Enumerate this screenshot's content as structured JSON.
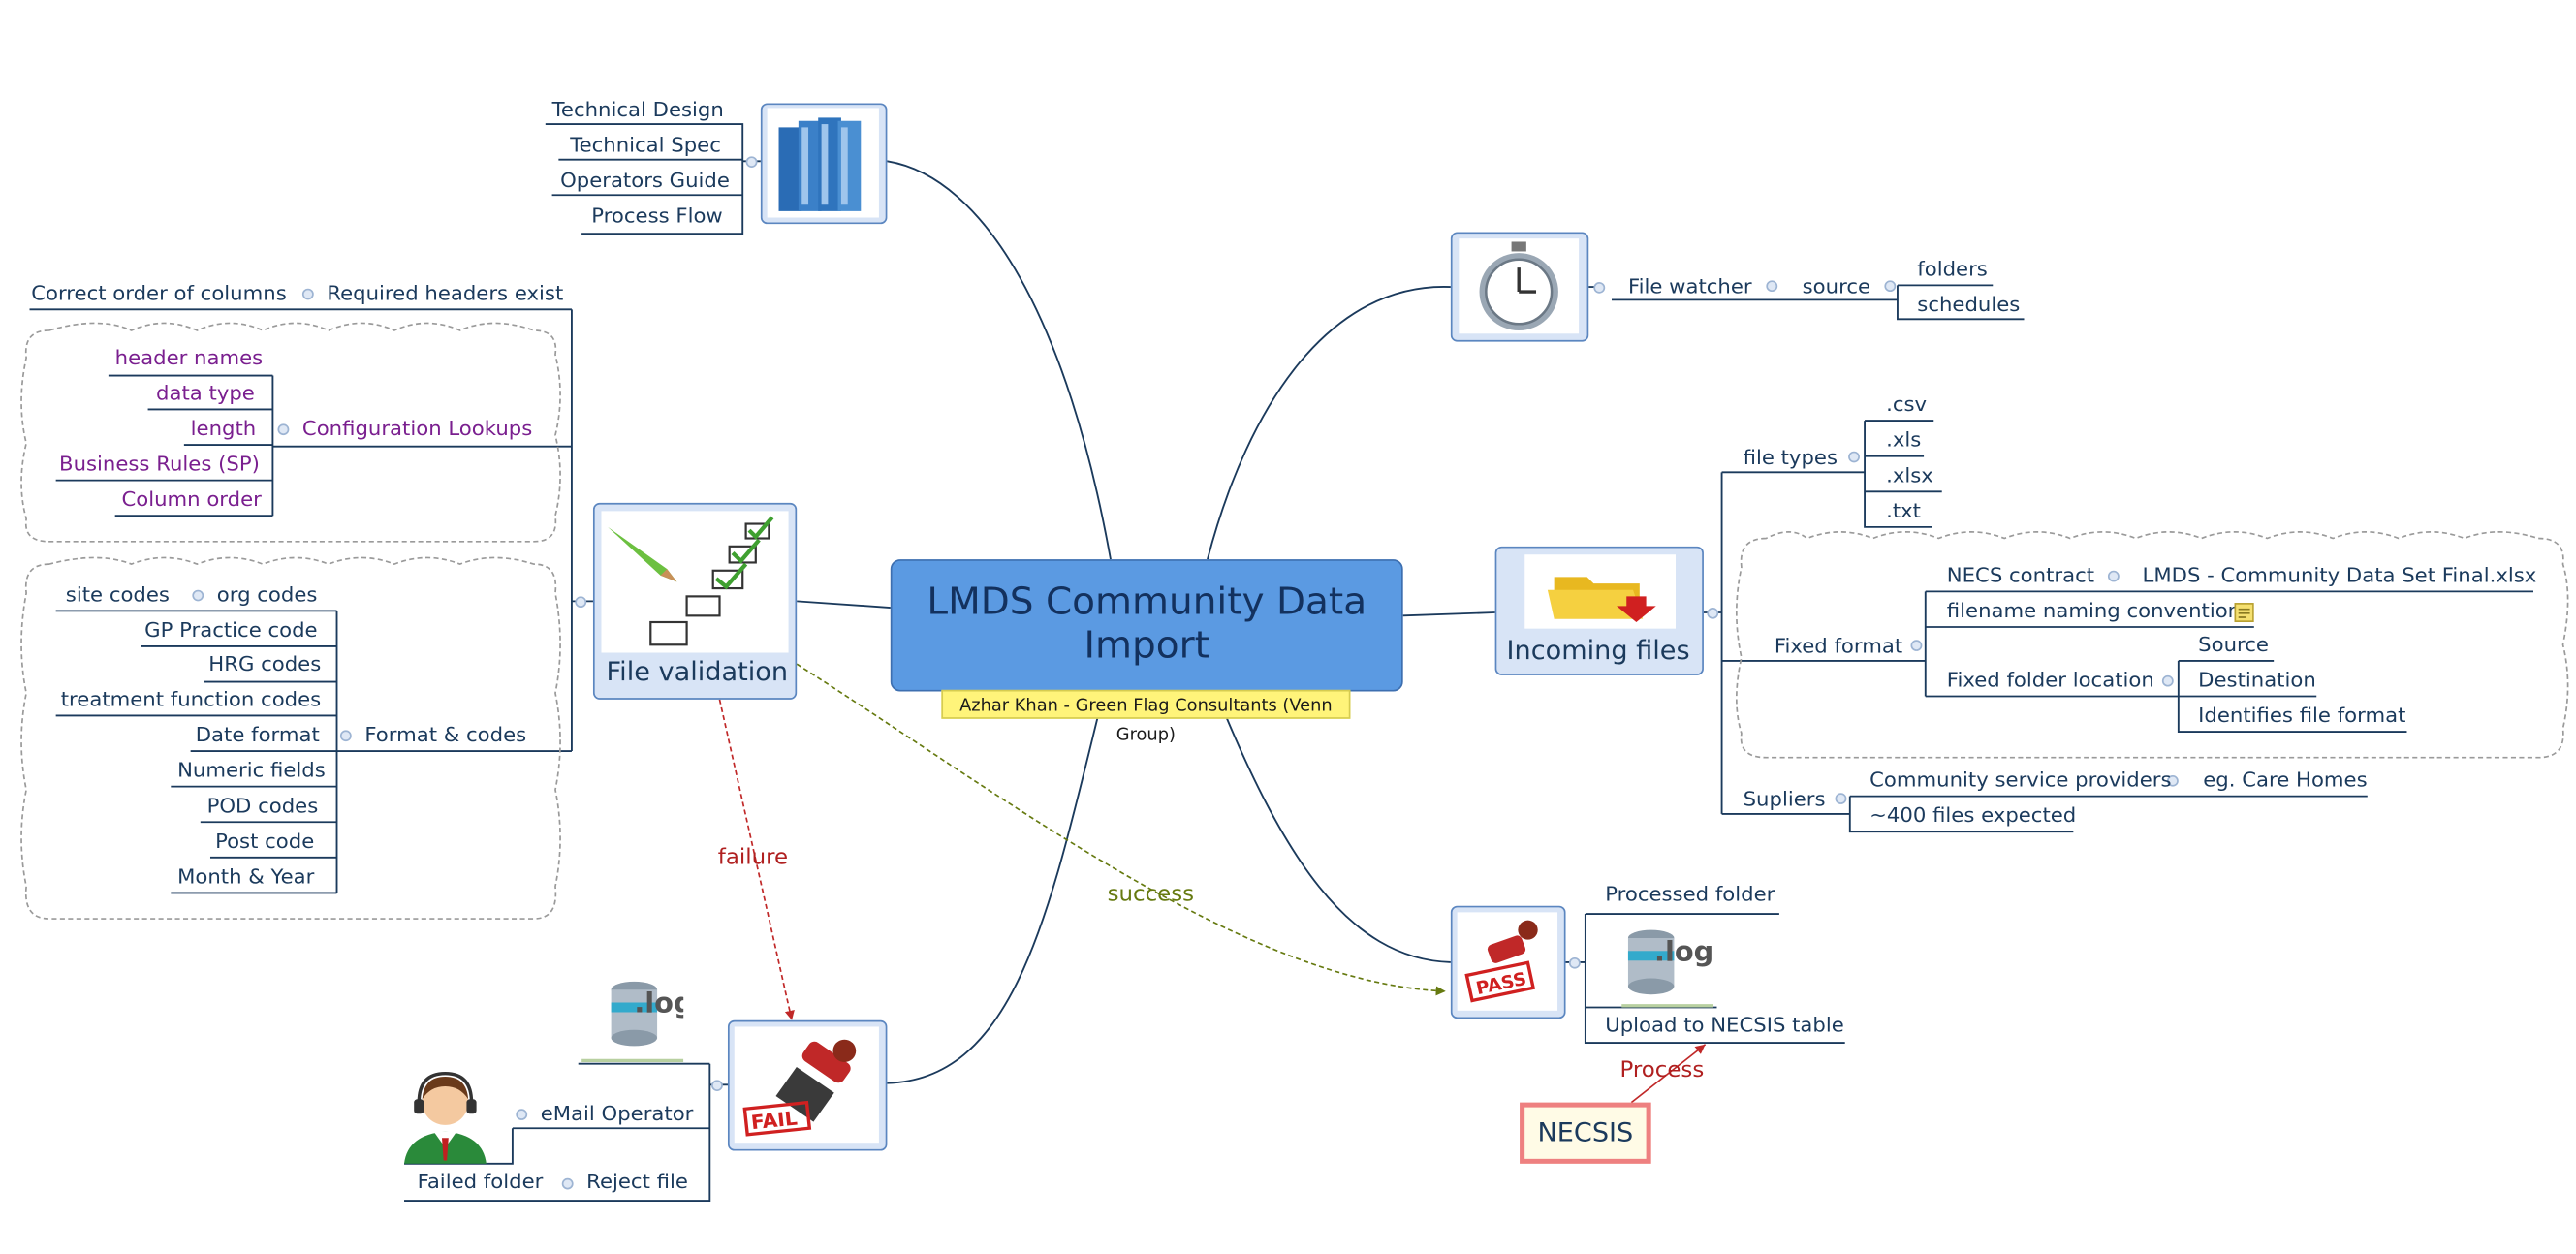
{
  "central": {
    "title_line1": "LMDS Community Data",
    "title_line2": "Import",
    "author": "Azhar Khan - Green Flag Consultants (Venn Group)"
  },
  "documents": {
    "icon": "book-stack-icon",
    "items": [
      "Technical Design",
      "Technical Spec",
      "Operators Guide",
      "Process Flow"
    ]
  },
  "file_watcher": {
    "icon": "stopwatch-icon",
    "label": "File watcher",
    "source": "source",
    "items": [
      "folders",
      "schedules"
    ]
  },
  "incoming": {
    "label": "Incoming files",
    "icon": "folder-icon",
    "file_types_label": "file types",
    "file_types": [
      ".csv",
      ".xls",
      ".xlsx",
      ".txt"
    ],
    "fixed_format_label": "Fixed format",
    "necs_contract": "NECS contract",
    "necs_file": "LMDS - Community Data Set Final.xlsx",
    "naming": "filename naming convention",
    "fixed_folder": "Fixed folder location",
    "folder_items": [
      "Source",
      "Destination",
      "Identifies file format"
    ],
    "suppliers_label": "Supliers",
    "community": "Community service providers",
    "care_homes": "eg. Care Homes",
    "expected": "~400 files expected"
  },
  "validation": {
    "label": "File validation",
    "icon": "checklist-icon",
    "correct_order": "Correct order of columns",
    "required_headers": "Required headers exist",
    "config_label": "Configuration Lookups",
    "config_items": [
      "header names",
      "data type",
      "length",
      "Business Rules (SP)",
      "Column order"
    ],
    "format_label": "Format & codes",
    "site_codes": "site codes",
    "org_codes": "org codes",
    "format_items": [
      "GP Practice code",
      "HRG codes",
      "treatment function codes",
      "Date format",
      "Numeric fields",
      "POD codes",
      "Post code",
      "Month & Year"
    ]
  },
  "pass": {
    "icon": "pass-stamp-icon",
    "processed": "Processed folder",
    "log_icon": "log-database-icon",
    "upload": "Upload to NECSIS table",
    "process": "Process",
    "necsis": "NECSIS"
  },
  "fail": {
    "icon": "fail-stamp-icon",
    "log_icon": "log-database-icon",
    "operator_icon": "operator-avatar-icon",
    "email": "eMail Operator",
    "failed_folder": "Failed folder",
    "reject": "Reject file"
  },
  "relations": {
    "failure": "failure",
    "success": "success"
  },
  "colors": {
    "line": "#1b3a5c",
    "central": "#5b9ae2",
    "topic_bg": "#d8e4f6",
    "failure": "#c02828",
    "success": "#667a10",
    "purple": "#7a1f8f"
  }
}
